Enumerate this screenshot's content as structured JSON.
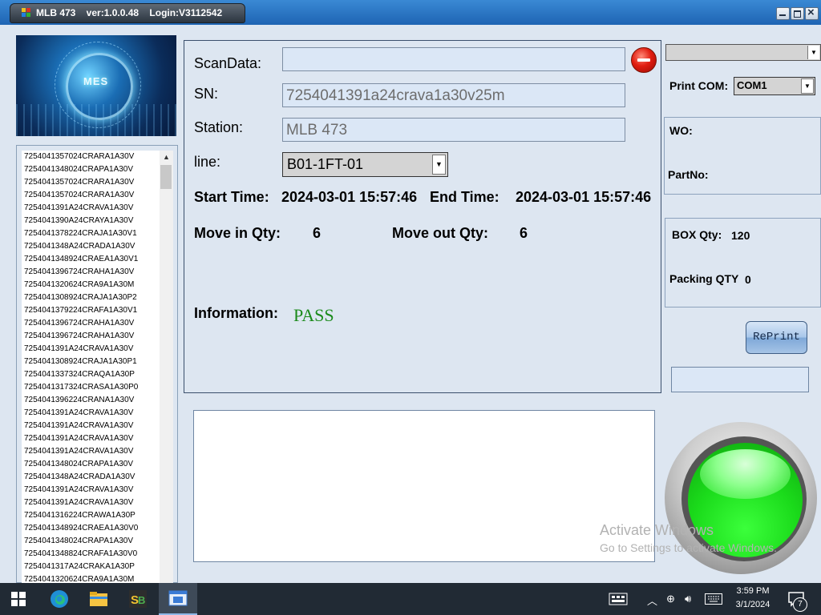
{
  "window": {
    "title": "MLB 473    ver:1.0.0.48    Login:V3112542",
    "minimize": "minimize",
    "maximize": "maximize",
    "close": "close"
  },
  "logo": {
    "text": "MES"
  },
  "sn_list": [
    "7254041357024CRARA1A30V",
    "7254041348024CRAPA1A30V",
    "7254041357024CRARA1A30V",
    "7254041357024CRARA1A30V",
    "7254041391A24CRAVA1A30V",
    "7254041390A24CRAYA1A30V",
    "7254041378224CRAJA1A30V1",
    "7254041348A24CRADA1A30V",
    "7254041348924CRAEA1A30V1",
    "7254041396724CRAHA1A30V",
    "7254041320624CRA9A1A30M",
    "7254041308924CRAJA1A30P2",
    "7254041379224CRAFA1A30V1",
    "7254041396724CRAHA1A30V",
    "7254041396724CRAHA1A30V",
    "7254041391A24CRAVA1A30V",
    "7254041308924CRAJA1A30P1",
    "7254041337324CRAQA1A30P",
    "7254041317324CRASA1A30P0",
    "7254041396224CRANA1A30V",
    "7254041391A24CRAVA1A30V",
    "7254041391A24CRAVA1A30V",
    "7254041391A24CRAVA1A30V",
    "7254041391A24CRAVA1A30V",
    "7254041348024CRAPA1A30V",
    "7254041348A24CRADA1A30V",
    "7254041391A24CRAVA1A30V",
    "7254041391A24CRAVA1A30V",
    "7254041316224CRAWA1A30P",
    "7254041348924CRAEA1A30V0",
    "7254041348024CRAPA1A30V",
    "7254041348824CRAFA1A30V0",
    "7254041317A24CRAKA1A30P",
    "7254041320624CRA9A1A30M"
  ],
  "form": {
    "scandata_label": "ScanData:",
    "scandata_value": "",
    "sn_label": "SN:",
    "sn_value": "7254041391a24crava1a30v25m",
    "station_label": "Station:",
    "station_value": "MLB 473",
    "line_label": "line:",
    "line_value": "B01-1FT-01",
    "start_time_label": "Start Time:",
    "start_time_value": "2024-03-01 15:57:46",
    "end_time_label": "End Time:",
    "end_time_value": "2024-03-01 15:57:46",
    "move_in_label": "Move in Qty:",
    "move_in_value": "6",
    "move_out_label": "Move out Qty:",
    "move_out_value": "6",
    "information_label": "Information:",
    "information_value": "PASS"
  },
  "side": {
    "top_select_value": "",
    "print_com_label": "Print COM:",
    "print_com_value": "COM1",
    "wo_label": "WO:",
    "wo_value": "",
    "partno_label": "PartNo:",
    "partno_value": "",
    "box_qty_label": "BOX Qty:",
    "box_qty_value": "120",
    "packing_qty_label": "Packing QTY",
    "packing_qty_value": "0",
    "reprint_label": "RePrint",
    "status_lamp_color": "#1bdb1b"
  },
  "watermark": {
    "line1": "Activate Windows",
    "line2": "Go to Settings to activate Windows."
  },
  "taskbar": {
    "time": "3:59 PM",
    "date": "3/1/2024",
    "notification_count": "7"
  }
}
